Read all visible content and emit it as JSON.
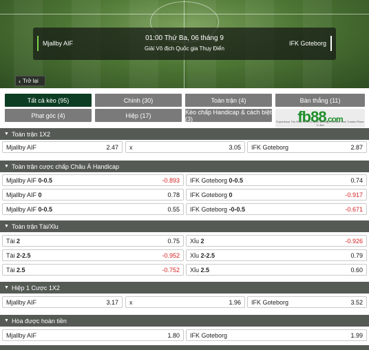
{
  "match": {
    "home_team": "Mjallby AIF",
    "away_team": "IFK Goteborg",
    "time": "01:00 Thứ Ba, 06 tháng 9",
    "league": "Giải Vô địch Quốc gia Thụy Điển"
  },
  "back_label": "Trở lại",
  "tabs": [
    {
      "label": "Tất cả kèo (95)",
      "active": true
    },
    {
      "label": "Chính (30)"
    },
    {
      "label": "Toàn trận (4)"
    },
    {
      "label": "Bàn thắng (11)"
    },
    {
      "label": "Phạt góc (4)"
    },
    {
      "label": "Hiệp (17)"
    },
    {
      "label": "Kèo chấp Handicap & cách biệt (3)"
    }
  ],
  "ad": {
    "logo": "fb88",
    "logo_suffix": ".com",
    "tagline": "Experience The Real Thrill of Sport Betting  |  Number One Trusted Place To Bet"
  },
  "sections": [
    {
      "title": "Toàn trận 1X2",
      "rows": [
        [
          {
            "label": "Mjallby AIF",
            "value": "2.47"
          },
          {
            "label": "x",
            "value": "3.05"
          },
          {
            "label": "IFK Goteborg",
            "value": "2.87"
          }
        ]
      ]
    },
    {
      "title": "Toàn trận cược chấp Châu Á Handicap",
      "rows": [
        [
          {
            "label": "Mjallby AIF",
            "line": "0-0.5",
            "value": "-0.893"
          },
          {
            "label": "IFK Goteborg",
            "line": "0-0.5",
            "value": "0.74"
          }
        ],
        [
          {
            "label": "Mjallby AIF",
            "line": "0",
            "value": "0.78"
          },
          {
            "label": "IFK Goteborg",
            "line": "0",
            "value": "-0.917"
          }
        ],
        [
          {
            "label": "Mjallby AIF",
            "line": "0-0.5",
            "value": "0.55"
          },
          {
            "label": "IFK Goteborg",
            "line": "-0-0.5",
            "value": "-0.671"
          }
        ]
      ]
    },
    {
      "title": "Toàn trận Tài/Xỉu",
      "rows": [
        [
          {
            "label": "Tài",
            "line": "2",
            "value": "0.75"
          },
          {
            "label": "Xỉu",
            "line": "2",
            "value": "-0.926"
          }
        ],
        [
          {
            "label": "Tài",
            "line": "2-2.5",
            "value": "-0.952"
          },
          {
            "label": "Xỉu",
            "line": "2-2.5",
            "value": "0.79"
          }
        ],
        [
          {
            "label": "Tài",
            "line": "2.5",
            "value": "-0.752"
          },
          {
            "label": "Xỉu",
            "line": "2.5",
            "value": "0.60"
          }
        ]
      ]
    },
    {
      "title": "Hiệp 1 Cược 1X2",
      "rows": [
        [
          {
            "label": "Mjallby AIF",
            "value": "3.17"
          },
          {
            "label": "x",
            "value": "1.96"
          },
          {
            "label": "IFK Goteborg",
            "value": "3.52"
          }
        ]
      ]
    },
    {
      "title": "Hòa được hoàn tiền",
      "rows": [
        [
          {
            "label": "Mjallby AIF",
            "value": "1.80"
          },
          {
            "label": "IFK Goteborg",
            "value": "1.99"
          }
        ]
      ]
    }
  ],
  "colors": {
    "negative": "#d32020",
    "active_tab": "#0d3d22",
    "tab": "#7a7a7a",
    "section_header": "#555a55"
  }
}
